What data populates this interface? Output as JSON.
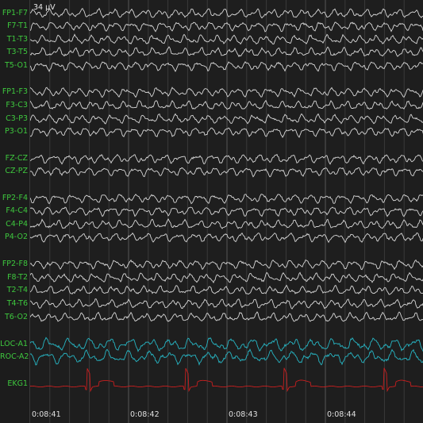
{
  "scale_label": "34 µV",
  "channels": [
    {
      "label": "FP1-F7",
      "group": "eeg"
    },
    {
      "label": "F7-T1",
      "group": "eeg"
    },
    {
      "label": "T1-T3",
      "group": "eeg"
    },
    {
      "label": "T3-T5",
      "group": "eeg"
    },
    {
      "label": "T5-O1",
      "group": "eeg"
    },
    {
      "label": "FP1-F3",
      "group": "eeg"
    },
    {
      "label": "F3-C3",
      "group": "eeg"
    },
    {
      "label": "C3-P3",
      "group": "eeg"
    },
    {
      "label": "P3-O1",
      "group": "eeg"
    },
    {
      "label": "FZ-CZ",
      "group": "eeg"
    },
    {
      "label": "CZ-PZ",
      "group": "eeg"
    },
    {
      "label": "FP2-F4",
      "group": "eeg"
    },
    {
      "label": "F4-C4",
      "group": "eeg"
    },
    {
      "label": "C4-P4",
      "group": "eeg"
    },
    {
      "label": "P4-O2",
      "group": "eeg"
    },
    {
      "label": "FP2-F8",
      "group": "eeg"
    },
    {
      "label": "F8-T2",
      "group": "eeg"
    },
    {
      "label": "T2-T4",
      "group": "eeg"
    },
    {
      "label": "T4-T6",
      "group": "eeg"
    },
    {
      "label": "T6-O2",
      "group": "eeg"
    },
    {
      "label": "LOC-A1",
      "group": "eog"
    },
    {
      "label": "ROC-A2",
      "group": "eog"
    },
    {
      "label": "EKG1",
      "group": "ekg"
    }
  ],
  "time_labels": [
    "0:08:41",
    "0:08:42",
    "0:08:43",
    "0:08:44"
  ],
  "colors": {
    "background": "#1e1e1e",
    "label": "#3ec83e",
    "eeg_trace": "#d8d8d8",
    "eog_trace": "#27b6c4",
    "ekg_trace": "#c81e1e",
    "grid": "#3a3a3a",
    "grid_major": "#555555",
    "text": "#e0e0e0"
  }
}
